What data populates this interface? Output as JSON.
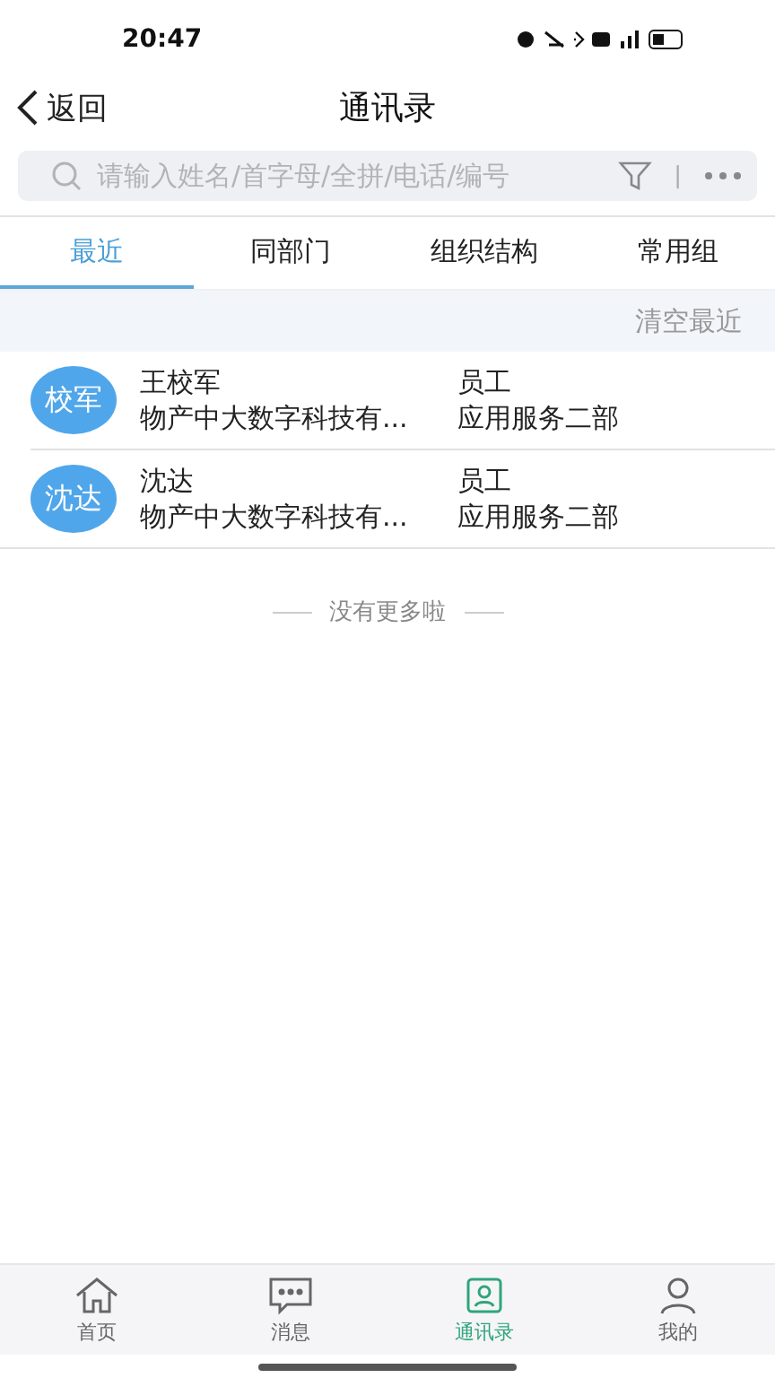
{
  "status_bar": {
    "time": "20:47"
  },
  "header": {
    "back": "返回",
    "title": "通讯录"
  },
  "search": {
    "placeholder": "请输入姓名/首字母/全拼/电话/编号",
    "separator": "|"
  },
  "tabs": [
    {
      "label": "最近",
      "selected": true
    },
    {
      "label": "同部门",
      "selected": false
    },
    {
      "label": "组织结构",
      "selected": false
    },
    {
      "label": "常用组",
      "selected": false
    }
  ],
  "clear_recent": "清空最近",
  "contacts": [
    {
      "avatar": "校军",
      "name": "王校军",
      "company": "物产中大数字科技有...",
      "role": "员工",
      "department": "应用服务二部"
    },
    {
      "avatar": "沈达",
      "name": "沈达",
      "company": "物产中大数字科技有...",
      "role": "员工",
      "department": "应用服务二部"
    }
  ],
  "end_note": "没有更多啦",
  "bottom_nav": [
    {
      "label": "首页",
      "kind": "home",
      "selected": false
    },
    {
      "label": "消息",
      "kind": "chat",
      "selected": false
    },
    {
      "label": "通讯录",
      "kind": "contacts",
      "selected": true
    },
    {
      "label": "我的",
      "kind": "person",
      "selected": false
    }
  ]
}
